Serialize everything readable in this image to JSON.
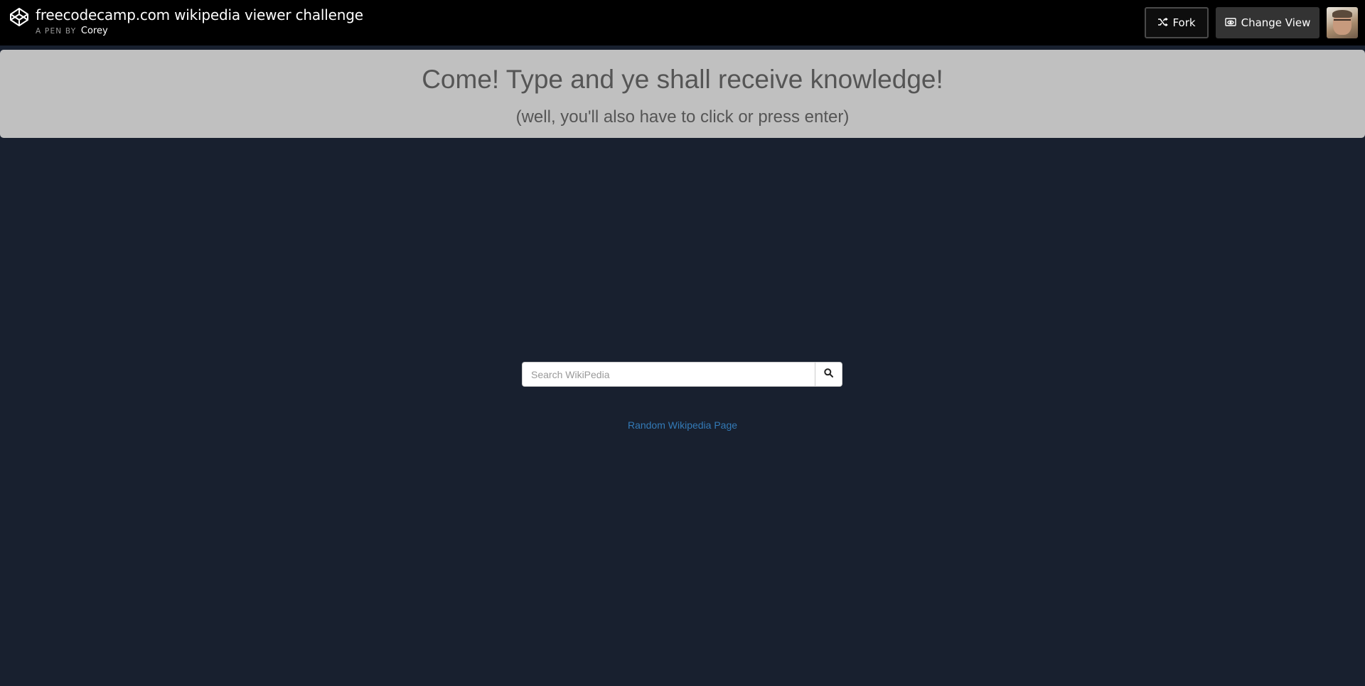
{
  "header": {
    "title": "freecodecamp.com wikipedia viewer challenge",
    "byline_prefix": "A PEN BY",
    "author": "Corey",
    "fork_label": "Fork",
    "change_view_label": "Change View",
    "logo_icon": "codepen-logo-icon",
    "fork_icon": "fork-icon",
    "change_view_icon": "eye-window-icon"
  },
  "banner": {
    "heading": "Come! Type and ye shall receive knowledge!",
    "subheading": "(well, you'll also have to click or press enter)"
  },
  "search": {
    "placeholder": "Search WikiPedia",
    "value": "",
    "button_icon": "search-icon"
  },
  "random_link": {
    "label": "Random Wikipedia Page"
  },
  "colors": {
    "page_background": "#18202f",
    "header_background": "#000000",
    "banner_background": "#c0c0c0",
    "link": "#337ab7"
  }
}
